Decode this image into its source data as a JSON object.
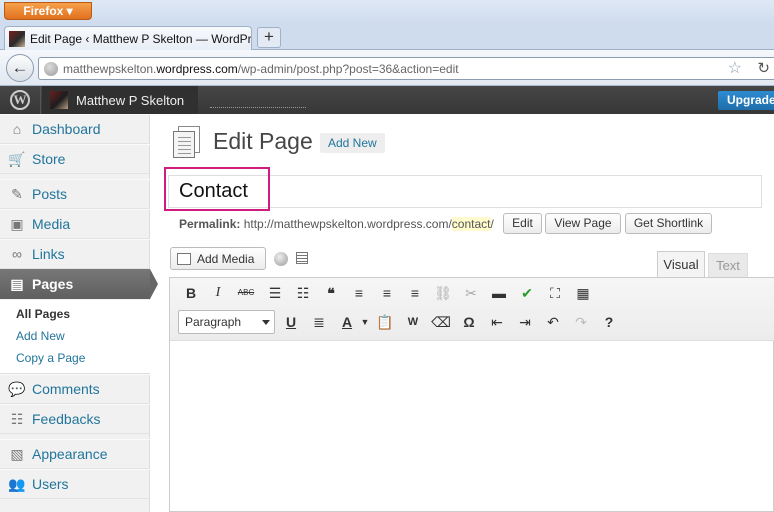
{
  "browser": {
    "menu_button": "Firefox",
    "tab_title": "Edit Page ‹ Matthew P Skelton — WordPress",
    "new_tab": "+",
    "url_prefix": "matthewpskelton.",
    "url_domain": "wordpress.com",
    "url_path": "/wp-admin/post.php?post=36&action=edit"
  },
  "adminbar": {
    "site_name": "Matthew P Skelton",
    "upgrade": "Upgrade"
  },
  "sidebar": {
    "items": [
      {
        "label": "Dashboard",
        "icon": "dashboard-icon",
        "glyph": "⌂"
      },
      {
        "label": "Store",
        "icon": "cart-icon",
        "glyph": "🛒"
      },
      {
        "label": "Posts",
        "icon": "pushpin-icon",
        "glyph": "✎"
      },
      {
        "label": "Media",
        "icon": "media-icon",
        "glyph": "▣"
      },
      {
        "label": "Links",
        "icon": "link-icon",
        "glyph": "∞"
      },
      {
        "label": "Pages",
        "icon": "pages-icon",
        "glyph": "▤"
      },
      {
        "label": "Comments",
        "icon": "comment-icon",
        "glyph": "💬"
      },
      {
        "label": "Feedbacks",
        "icon": "feedback-icon",
        "glyph": "☷"
      },
      {
        "label": "Appearance",
        "icon": "appearance-icon",
        "glyph": "▧"
      },
      {
        "label": "Users",
        "icon": "users-icon",
        "glyph": "👥"
      }
    ],
    "submenu": [
      "All Pages",
      "Add New",
      "Copy a Page"
    ]
  },
  "main": {
    "heading": "Edit Page",
    "add_new": "Add New",
    "title_value": "Contact",
    "permalink_label": "Permalink:",
    "permalink_base": "http://matthewpskelton.wordpress.com/",
    "permalink_slug": "contact",
    "permalink_trail": "/",
    "buttons": {
      "edit": "Edit",
      "view_page": "View Page",
      "shortlink": "Get Shortlink"
    },
    "add_media": "Add Media",
    "tab_visual": "Visual",
    "tab_text": "Text",
    "format_value": "Paragraph"
  },
  "toolbar": {
    "row1": [
      "B",
      "I",
      "ABC",
      "☰",
      "☷",
      "❝",
      "≡",
      "≡",
      "≡",
      "⛓",
      "✂",
      "▬",
      "✔",
      "⛶",
      "▦"
    ],
    "row2": [
      "U",
      "≣",
      "A",
      "📋",
      "W",
      "⌫",
      "Ω",
      "⇤",
      "⇥",
      "↶",
      "↷",
      "?"
    ]
  }
}
